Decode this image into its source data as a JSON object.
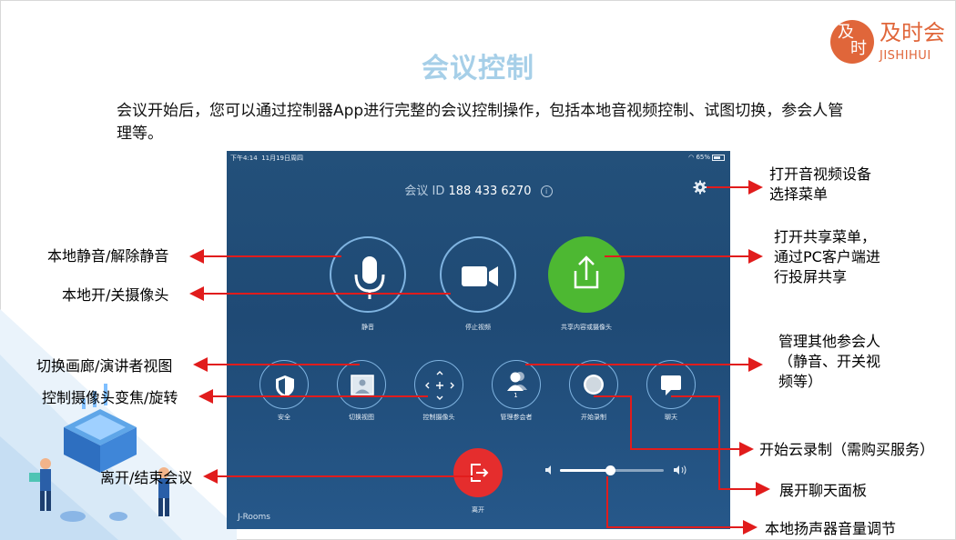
{
  "logo": {
    "seal_char1": "及",
    "seal_char2": "时",
    "name_cn": "及时会",
    "name_en": "JISHIHUI",
    "color": "#e0663a"
  },
  "page": {
    "title": "会议控制",
    "intro": "会议开始后，您可以通过控制器App进行完整的会议控制操作，包括本地音视频控制、试图切换，参会人管理等。"
  },
  "tablet": {
    "status_time": "下午4:14",
    "status_date": "11月19日周四",
    "status_battery": "65%",
    "meeting_id_label": "会议 ID",
    "meeting_id_value": "188 433 6270",
    "info_glyph": "i",
    "buttons": {
      "mute": "静音",
      "stop_video": "停止视频",
      "share": "共享内容或摄像头",
      "security": "安全",
      "switch_view": "切换视图",
      "camera_control": "控制摄像头",
      "manage_participants": "管理参会者",
      "participant_count": "1",
      "start_recording": "开始录制",
      "chat": "聊天",
      "leave": "离开"
    },
    "volume_level": 0.48,
    "brand": "J-Rooms",
    "colors": {
      "accent_green": "#4db832",
      "leave_red": "#e52d2d",
      "ring": "#7fb3e0"
    }
  },
  "annotations": {
    "device_menu_1": "打开音视频设备",
    "device_menu_2": "选择菜单",
    "share_menu_1": "打开共享菜单，",
    "share_menu_2": "通过PC客户端进",
    "share_menu_3": "行投屏共享",
    "mute": "本地静音/解除静音",
    "camera": "本地开/关摄像头",
    "manage_1": "管理其他参会人",
    "manage_2": "（静音、开关视",
    "manage_3": "频等）",
    "view": "切换画廊/演讲者视图",
    "cam_control": "控制摄像头变焦/旋转",
    "record": "开始云录制（需购买服务）",
    "leave": "离开/结束会议",
    "chat": "展开聊天面板",
    "volume": "本地扬声器音量调节"
  }
}
